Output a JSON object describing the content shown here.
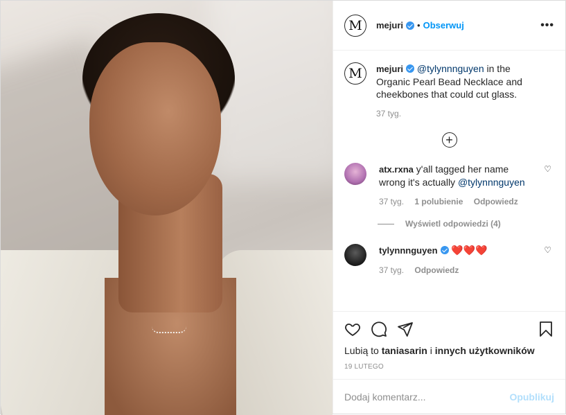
{
  "header": {
    "username": "mejuri",
    "dot": "•",
    "follow_label": "Obserwuj",
    "more_label": "•••",
    "avatar_letter": "M"
  },
  "caption": {
    "username": "mejuri",
    "mention": "@tylynnnguyen",
    "text": " in the Organic Pearl Bead Necklace and cheekbones that could cut glass.",
    "time": "37 tyg."
  },
  "comments": [
    {
      "username": "atx.rxna",
      "text": " y'all tagged her name wrong it's actually ",
      "mention": "@tylynnnguyen",
      "time": "37 tyg.",
      "likes": "1 polubienie",
      "reply": "Odpowiedz",
      "view_replies": "Wyświetl odpowiedzi (4)"
    },
    {
      "username": "tylynnnguyen",
      "hearts": " ❤️❤️❤️",
      "time": "37 tyg.",
      "reply": "Odpowiedz"
    }
  ],
  "likes": {
    "prefix": "Lubią to ",
    "user": "taniasarin",
    "middle": " i ",
    "rest": "innych użytkowników"
  },
  "date": "19 LUTEGO",
  "add_comment": {
    "placeholder": "Dodaj komentarz...",
    "publish_label": "Opublikuj"
  },
  "icons": {
    "like": "heart-icon",
    "comment": "comment-icon",
    "share": "paper-plane-icon",
    "save": "bookmark-icon",
    "more": "more-options-icon",
    "load_more": "plus-circle-icon"
  },
  "colors": {
    "accent": "#0095f6",
    "verified": "#3897f0",
    "publish_disabled": "#b2dffc",
    "muted": "#8e8e8e",
    "heart": "#e0245e"
  }
}
